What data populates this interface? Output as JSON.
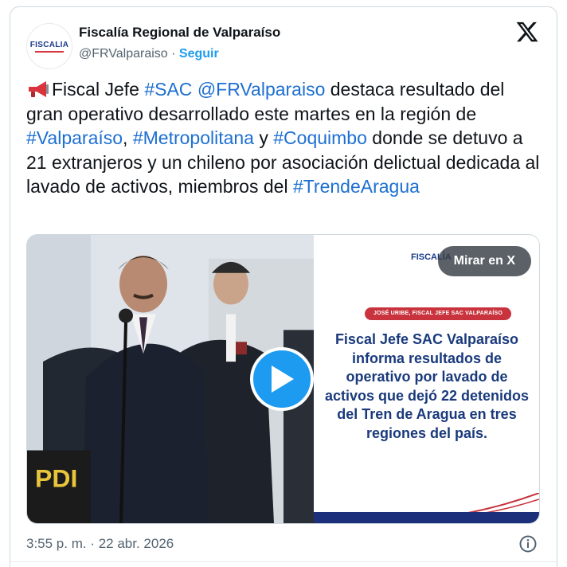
{
  "author": {
    "avatar_text": "FISCALIA",
    "name": "Fiscalía Regional de Valparaíso",
    "handle": "@FRValparaiso",
    "separator": " · ",
    "follow_label": "Seguir"
  },
  "x_icon": "x-logo-icon",
  "tweet": {
    "emoji_icon": "megaphone-icon",
    "segments": [
      {
        "text": "Fiscal Jefe ",
        "link": false
      },
      {
        "text": "#SAC",
        "link": true
      },
      {
        "text": " ",
        "link": false
      },
      {
        "text": "@FRValparaiso",
        "link": true
      },
      {
        "text": " destaca resultado del gran operativo desarrollado este martes en la región de ",
        "link": false
      },
      {
        "text": "#Valparaíso",
        "link": true
      },
      {
        "text": ", ",
        "link": false
      },
      {
        "text": "#Metropolitana",
        "link": true
      },
      {
        "text": " y ",
        "link": false
      },
      {
        "text": "#Coquimbo",
        "link": true
      },
      {
        "text": " donde se detuvo a 21 extranjeros y un chileno por asociación delictual dedicada al lavado de activos, miembros del ",
        "link": false
      },
      {
        "text": "#TrendeAragua",
        "link": true
      }
    ]
  },
  "media": {
    "watch_label": "Mirar en X",
    "play_icon": "play-icon",
    "photo_sign_text": "PDI",
    "panel_logo": "FISCALÍA",
    "byline": "JOSÉ URIBE, FISCAL JEFE SAC VALPARAÍSO",
    "headline": "Fiscal Jefe SAC Valparaíso informa resultados de operativo por lavado de activos que dejó 22 detenidos del Tren de Aragua en tres regiones del país."
  },
  "footer": {
    "timestamp": "3:55 p. m. · 22 abr. 2026",
    "info_icon": "info-icon"
  },
  "colors": {
    "link": "#1d6fd1",
    "follow": "#1d9bf0",
    "play": "#1d9bf0",
    "headline": "#1a3a7c",
    "byline_bg": "#c8333d"
  }
}
